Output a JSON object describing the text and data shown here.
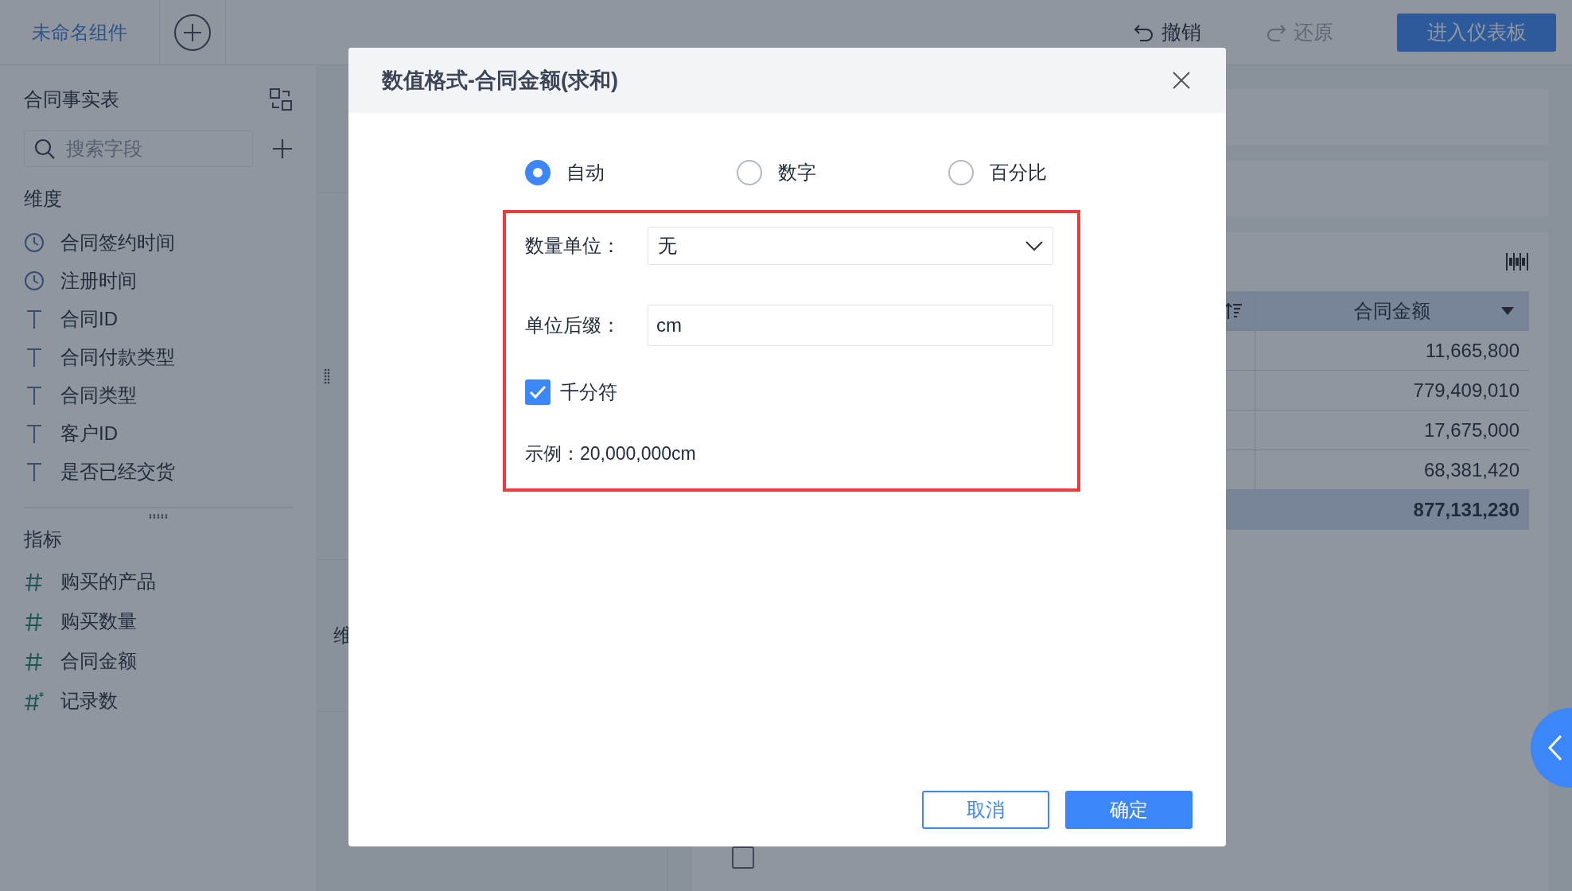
{
  "top_bar": {
    "tab": "未命名组件",
    "undo": {
      "label": "撤销",
      "disabled": false
    },
    "redo": {
      "label": "还原",
      "disabled": true
    },
    "enter_button": "进入仪表板"
  },
  "sidebar": {
    "title": "合同事实表",
    "search": {
      "placeholder": "搜索字段"
    },
    "groups": [
      {
        "title": "维度",
        "fields": [
          {
            "kind": "date",
            "label": "合同签约时间"
          },
          {
            "kind": "date",
            "label": "注册时间"
          },
          {
            "kind": "text",
            "label": "合同ID"
          },
          {
            "kind": "text",
            "label": "合同付款类型"
          },
          {
            "kind": "text",
            "label": "合同类型"
          },
          {
            "kind": "text",
            "label": "客户ID"
          },
          {
            "kind": "text",
            "label": "是否已经交货"
          }
        ]
      },
      {
        "title": "指标",
        "fields": [
          {
            "kind": "number",
            "label": "购买的产品"
          },
          {
            "kind": "number",
            "label": "购买数量"
          },
          {
            "kind": "number",
            "label": "合同金额"
          },
          {
            "kind": "count",
            "label": "记录数"
          }
        ]
      }
    ]
  },
  "middle": {
    "label": "维"
  },
  "table": {
    "column": "合同金额",
    "rows": [
      "11,665,800",
      "779,409,010",
      "17,675,000",
      "68,381,420"
    ],
    "total": "877,131,230"
  },
  "view_all": {
    "checked": false
  },
  "dialog": {
    "title": "数值格式-合同金额(求和)",
    "formats": [
      {
        "label": "自动",
        "selected": true
      },
      {
        "label": "数字",
        "selected": false
      },
      {
        "label": "百分比",
        "selected": false
      }
    ],
    "unit": {
      "label": "数量单位：",
      "value": "无"
    },
    "suffix": {
      "label": "单位后缀：",
      "value": "cm"
    },
    "separator": {
      "label": "千分符",
      "checked": true
    },
    "example": "示例：20,000,000cm",
    "buttons": [
      {
        "kind": "secondary",
        "label": "取消"
      },
      {
        "kind": "primary",
        "label": "确定"
      }
    ]
  }
}
